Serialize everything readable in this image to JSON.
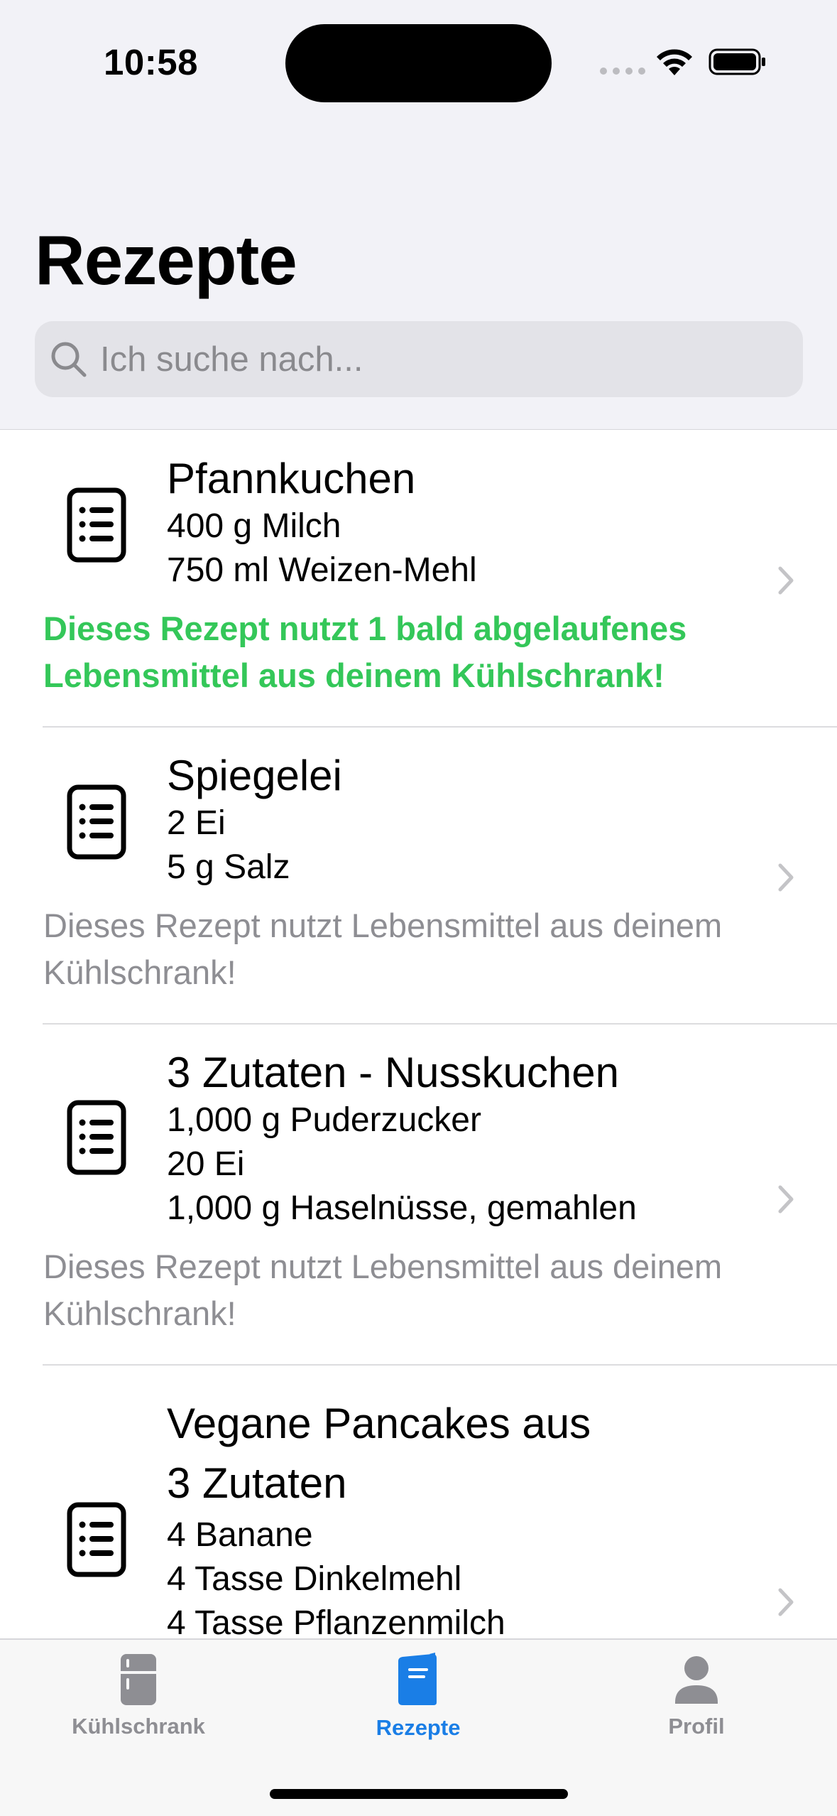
{
  "status": {
    "time": "10:58"
  },
  "page": {
    "title": "Rezepte"
  },
  "search": {
    "placeholder": "Ich suche nach..."
  },
  "recipes": [
    {
      "title": "Pfannkuchen",
      "ingredients": [
        "400 g Milch",
        "750 ml Weizen-Mehl"
      ],
      "note": "Dieses Rezept nutzt 1 bald abgelaufenes Lebensmittel aus deinem Kühlschrank!",
      "note_style": "expiring"
    },
    {
      "title": "Spiegelei",
      "ingredients": [
        "2  Ei",
        "5 g Salz"
      ],
      "note": "Dieses Rezept nutzt Lebensmittel aus deinem Kühlschrank!",
      "note_style": "normal"
    },
    {
      "title": "3 Zutaten - Nusskuchen",
      "ingredients": [
        "1,000 g Puderzucker",
        "20  Ei",
        "1,000 g Haselnüsse, gemahlen"
      ],
      "note": "Dieses Rezept nutzt Lebensmittel aus deinem Kühlschrank!",
      "note_style": "normal"
    },
    {
      "title_lines": [
        "Vegane Pancakes aus",
        "3 Zutaten"
      ],
      "ingredients": [
        "4  Banane",
        "4 Tasse Dinkelmehl",
        "4 Tasse Pflanzenmilch"
      ]
    }
  ],
  "tabs": [
    {
      "label": "Kühlschrank",
      "icon": "fridge-icon",
      "active": false
    },
    {
      "label": "Rezepte",
      "icon": "book-icon",
      "active": true
    },
    {
      "label": "Profil",
      "icon": "person-icon",
      "active": false
    }
  ],
  "colors": {
    "accent": "#1a7ee6",
    "expiring_note": "#34c759",
    "secondary_text": "#8e8e93",
    "inactive_tab": "#8e8e93"
  }
}
